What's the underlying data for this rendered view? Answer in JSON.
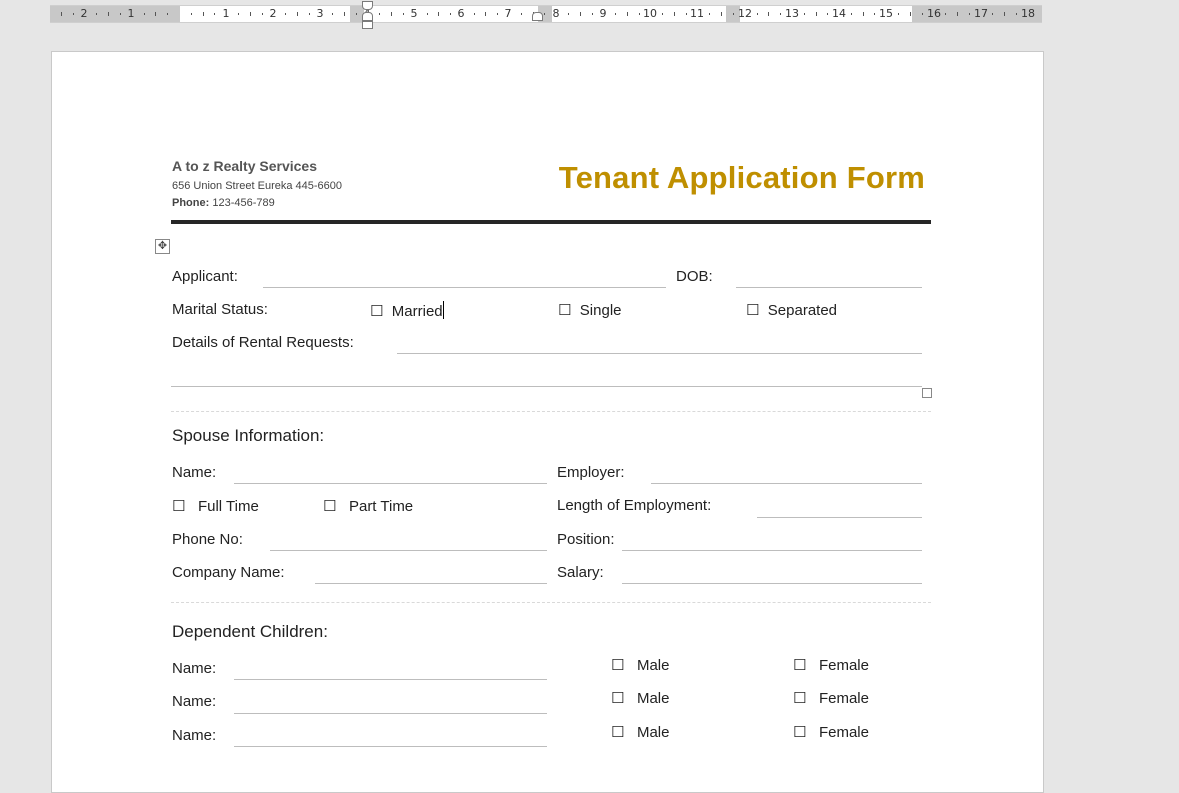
{
  "ruler": {
    "left_numbers": [
      "2",
      "1"
    ],
    "numbers": [
      "1",
      "2",
      "3",
      "4",
      "5",
      "6",
      "7",
      "8",
      "9",
      "10",
      "11",
      "12",
      "13",
      "14",
      "15",
      "16",
      "17",
      "18"
    ]
  },
  "header": {
    "company": "A to z Realty Services",
    "address": "656 Union Street Eureka 445-6600",
    "phone_label": "Phone:",
    "phone_value": "123-456-789",
    "form_title": "Tenant Application Form"
  },
  "applicant": {
    "applicant_label": "Applicant:",
    "dob_label": "DOB:",
    "marital_label": "Marital Status:",
    "checkbox_glyph": "☐",
    "married": "Married",
    "single": "Single",
    "separated": "Separated",
    "rental_label": "Details of Rental Requests:"
  },
  "spouse": {
    "heading": "Spouse Information:",
    "name_label": "Name:",
    "employer_label": "Employer:",
    "full_time": "Full Time",
    "part_time": "Part Time",
    "length_label": "Length of Employment:",
    "phone_label": "Phone No:",
    "position_label": "Position:",
    "company_label": "Company Name:",
    "salary_label": "Salary:"
  },
  "children": {
    "heading": "Dependent Children:",
    "rows": [
      {
        "name_label": "Name:",
        "male": "Male",
        "female": "Female"
      },
      {
        "name_label": "Name:",
        "male": "Male",
        "female": "Female"
      },
      {
        "name_label": "Name:",
        "male": "Male",
        "female": "Female"
      }
    ]
  },
  "colors": {
    "title": "#bf8f00",
    "rule": "#262626",
    "canvas": "#e6e6e6"
  }
}
